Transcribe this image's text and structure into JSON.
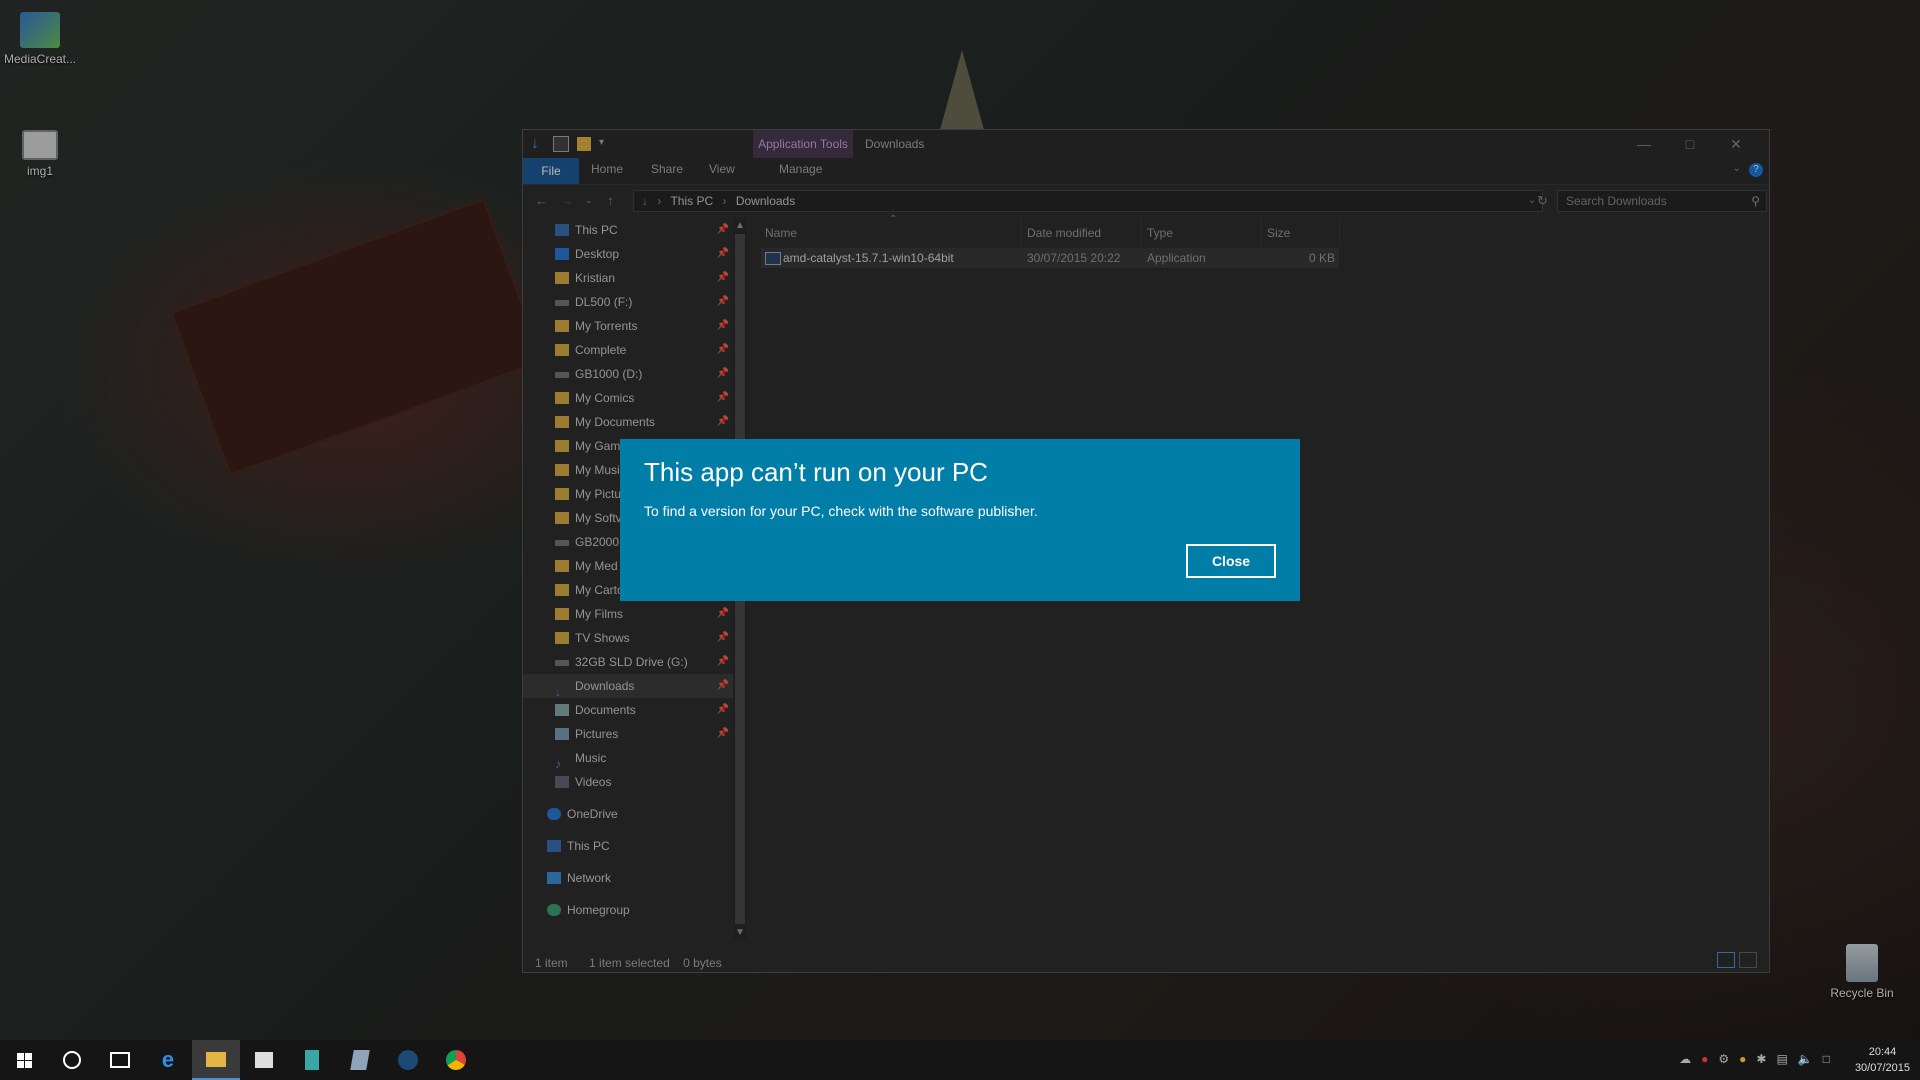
{
  "desktop": {
    "icons": [
      {
        "label": "MediaCreat..."
      },
      {
        "label": "img1"
      },
      {
        "label": "Recycle Bin"
      }
    ]
  },
  "explorer": {
    "context_tab": "Application Tools",
    "title": "Downloads",
    "ribbon_tabs": [
      "File",
      "Home",
      "Share",
      "View",
      "Manage"
    ],
    "address": {
      "path": [
        "This PC",
        "Downloads"
      ],
      "separator": "›"
    },
    "search_placeholder": "Search Downloads",
    "nav": [
      {
        "label": "This PC",
        "pin": true,
        "icon": "pc-icon"
      },
      {
        "label": "Desktop",
        "pin": true,
        "icon": "desktop-icon"
      },
      {
        "label": "Kristian",
        "pin": true,
        "icon": "folder-icon"
      },
      {
        "label": "DL500 (F:)",
        "pin": true,
        "icon": "drive-icon"
      },
      {
        "label": "My Torrents",
        "pin": true,
        "icon": "folder-icon"
      },
      {
        "label": "Complete",
        "pin": true,
        "icon": "folder-icon"
      },
      {
        "label": "GB1000 (D:)",
        "pin": true,
        "icon": "drive-icon"
      },
      {
        "label": "My Comics",
        "pin": true,
        "icon": "folder-icon"
      },
      {
        "label": "My Documents",
        "pin": true,
        "icon": "folder-icon"
      },
      {
        "label": "My Gam",
        "pin": false,
        "icon": "folder-icon"
      },
      {
        "label": "My Musi",
        "pin": false,
        "icon": "folder-icon"
      },
      {
        "label": "My Pictu",
        "pin": false,
        "icon": "folder-icon"
      },
      {
        "label": "My Softv",
        "pin": false,
        "icon": "folder-icon"
      },
      {
        "label": "GB2000 (",
        "pin": false,
        "icon": "drive-icon"
      },
      {
        "label": "My Med",
        "pin": false,
        "icon": "folder-icon"
      },
      {
        "label": "My Carto",
        "pin": false,
        "icon": "folder-icon"
      },
      {
        "label": "My Films",
        "pin": true,
        "icon": "folder-icon"
      },
      {
        "label": "TV Shows",
        "pin": true,
        "icon": "folder-icon"
      },
      {
        "label": "32GB SLD Drive (G:)",
        "pin": true,
        "icon": "drive-icon"
      },
      {
        "label": "Downloads",
        "pin": true,
        "icon": "download-icon",
        "selected": true
      },
      {
        "label": "Documents",
        "pin": true,
        "icon": "documents-icon"
      },
      {
        "label": "Pictures",
        "pin": true,
        "icon": "pictures-icon"
      },
      {
        "label": "Music",
        "pin": false,
        "icon": "music-icon"
      },
      {
        "label": "Videos",
        "pin": false,
        "icon": "videos-icon"
      }
    ],
    "nav_top": [
      {
        "label": "OneDrive",
        "icon": "onedrive-icon"
      },
      {
        "label": "This PC",
        "icon": "pc-icon"
      },
      {
        "label": "Network",
        "icon": "network-icon"
      },
      {
        "label": "Homegroup",
        "icon": "homegroup-icon"
      }
    ],
    "columns": [
      "Name",
      "Date modified",
      "Type",
      "Size"
    ],
    "files": [
      {
        "name": "amd-catalyst-15.7.1-win10-64bit",
        "date": "30/07/2015 20:22",
        "type": "Application",
        "size": "0 KB"
      }
    ],
    "status": {
      "count": "1 item",
      "selected": "1 item selected",
      "bytes": "0 bytes"
    }
  },
  "dialog": {
    "title": "This app can’t run on your PC",
    "message": "To find a version for your PC, check with the software publisher.",
    "close_label": "Close"
  },
  "taskbar": {
    "clock_time": "20:44",
    "clock_date": "30/07/2015"
  },
  "colors": {
    "dialog_bg": "#007ea8",
    "context_tab": "#4a3b52",
    "file_tab": "#1e5a9a"
  }
}
